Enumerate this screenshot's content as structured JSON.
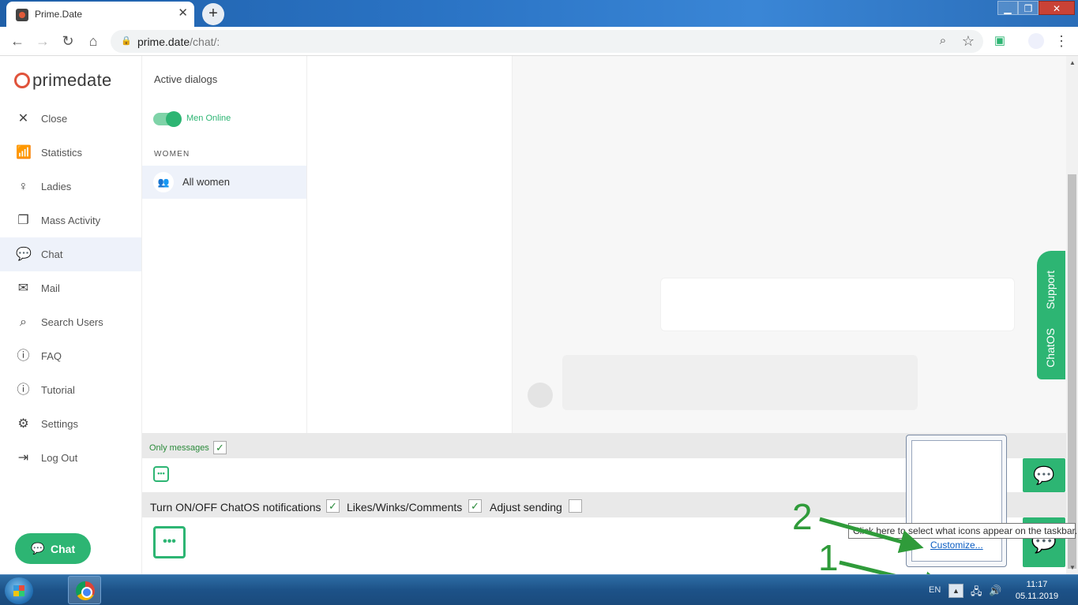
{
  "browser": {
    "tab_title": "Prime.Date",
    "tab_close": "✕",
    "new_tab": "+",
    "address_domain": "prime.date",
    "address_path": "/chat/:",
    "window_controls": {
      "minimize": "▁",
      "maximize": "❐",
      "close": "✕"
    }
  },
  "sidebar": {
    "logo_text": "primedate",
    "items": [
      {
        "icon": "close-icon",
        "label": "Close"
      },
      {
        "icon": "statistics-icon",
        "label": "Statistics"
      },
      {
        "icon": "ladies-icon",
        "label": "Ladies"
      },
      {
        "icon": "mass-activity-icon",
        "label": "Mass Activity"
      },
      {
        "icon": "chat-icon",
        "label": "Chat"
      },
      {
        "icon": "mail-icon",
        "label": "Mail"
      },
      {
        "icon": "search-icon",
        "label": "Search Users"
      },
      {
        "icon": "info-icon",
        "label": "FAQ"
      },
      {
        "icon": "info-icon",
        "label": "Tutorial"
      },
      {
        "icon": "gear-icon",
        "label": "Settings"
      },
      {
        "icon": "logout-icon",
        "label": "Log Out"
      }
    ],
    "chat_button": "Chat"
  },
  "dialogs": {
    "heading": "Active dialogs",
    "toggle_label": "Men Online",
    "toggle_on": true,
    "section": "WOMEN",
    "all_women": "All women"
  },
  "support_widget": {
    "line1": "Support",
    "line2": "ChatOS"
  },
  "notifications": {
    "only_messages": "Only messages",
    "only_messages_checked": true,
    "turn_onoff": "Turn ON/OFF ChatOS notifications",
    "turn_onoff_checked": true,
    "likes": "Likes/Winks/Comments",
    "likes_checked": true,
    "adjust": "Adjust sending",
    "adjust_checked": false
  },
  "tray_popup": {
    "customize": "Customize...",
    "tooltip": "Click here to select what icons appear on the taskbar."
  },
  "annotations": {
    "one": "1",
    "two": "2"
  },
  "taskbar": {
    "lang": "EN",
    "time": "11:17",
    "date": "05.11.2019"
  },
  "colors": {
    "accent": "#2db573",
    "brand": "#e0533b",
    "annotation": "#2f9b3a"
  }
}
